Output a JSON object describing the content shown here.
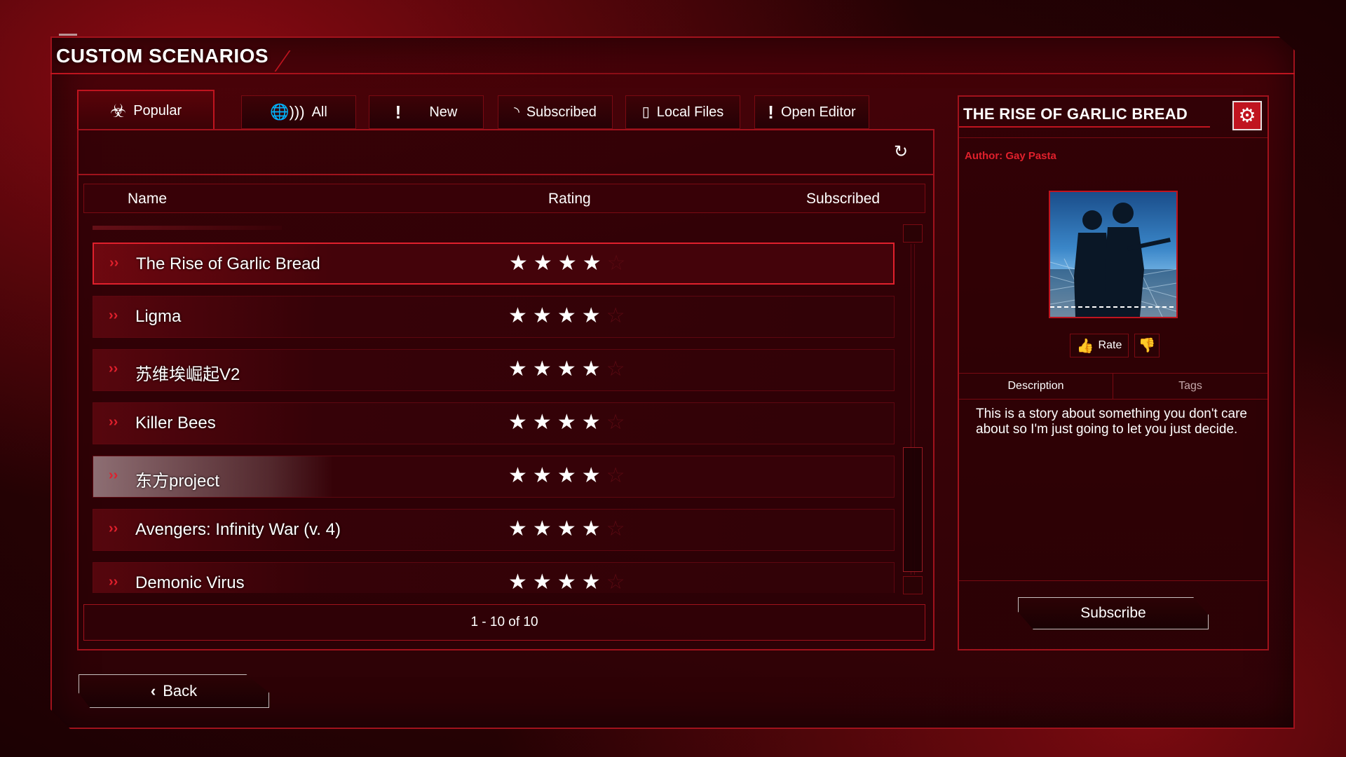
{
  "header": {
    "title": "CUSTOM SCENARIOS"
  },
  "tabs": [
    {
      "label": "Popular",
      "icon": "biohazard-icon",
      "active": true
    },
    {
      "label": "All",
      "icon": "globe-signal-icon"
    },
    {
      "label": "New",
      "icon": "exclamation-icon"
    },
    {
      "label": "Subscribed",
      "icon": "rss-icon"
    },
    {
      "label": "Local Files",
      "icon": "file-icon"
    },
    {
      "label": "Open Editor",
      "icon": "exclamation-icon"
    }
  ],
  "columns": {
    "name": "Name",
    "rating": "Rating",
    "subscribed": "Subscribed"
  },
  "scenarios": [
    {
      "name": "The Rise of Garlic Bread",
      "rating": 4,
      "max": 5,
      "selected": true
    },
    {
      "name": "Ligma",
      "rating": 4,
      "max": 5
    },
    {
      "name": "苏维埃崛起V2",
      "rating": 4,
      "max": 5
    },
    {
      "name": "Killer Bees",
      "rating": 4,
      "max": 5
    },
    {
      "name": "东方project",
      "rating": 4,
      "max": 5
    },
    {
      "name": "Avengers: Infinity War (v. 4)",
      "rating": 4,
      "max": 5
    },
    {
      "name": "Demonic Virus",
      "rating": 4,
      "max": 5
    }
  ],
  "pager": {
    "text": "1 - 10 of 10"
  },
  "detail": {
    "title": "THE RISE OF GARLIC BREAD",
    "author": "Author: Gay Pasta",
    "rate_label": "Rate",
    "tabs": [
      "Description",
      "Tags"
    ],
    "description": "This is a story about something you don't care about so I'm just going to let you just decide.",
    "subscribe_label": "Subscribe"
  },
  "back_label": "Back",
  "colors": {
    "accent": "#c0141f",
    "background": "#2a0205"
  }
}
